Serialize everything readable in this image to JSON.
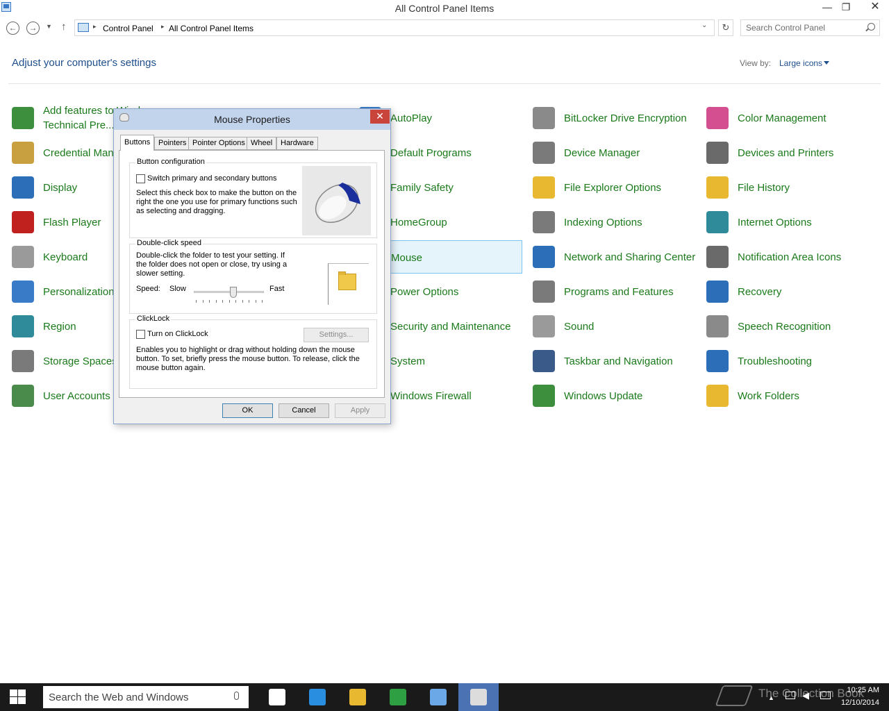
{
  "window": {
    "title": "All Control Panel Items",
    "minimize": "—",
    "maximize": "❐",
    "close": "✕"
  },
  "address": {
    "crumbs": [
      "Control Panel",
      "All Control Panel Items"
    ],
    "search_placeholder": "Search Control Panel"
  },
  "header": {
    "heading": "Adjust your computer's settings",
    "view_by_label": "View by:",
    "view_by_value": "Large icons"
  },
  "items": [
    {
      "label": "Add features to Windows Technical Pre...",
      "icon": "add-features-icon",
      "color": "#3d8f3d"
    },
    {
      "label": "AutoPlay",
      "icon": "autoplay-icon",
      "color": "#3a7bc8"
    },
    {
      "label": "BitLocker Drive Encryption",
      "icon": "bitlocker-icon",
      "color": "#8a8a8a"
    },
    {
      "label": "Color Management",
      "icon": "color-management-icon",
      "color": "#d44f8f"
    },
    {
      "label": "Credential Manager",
      "icon": "credential-manager-icon",
      "color": "#c8a040"
    },
    {
      "label": "Default Programs",
      "icon": "default-programs-icon",
      "color": "#3d8f3d"
    },
    {
      "label": "Device Manager",
      "icon": "device-manager-icon",
      "color": "#7a7a7a"
    },
    {
      "label": "Devices and Printers",
      "icon": "devices-printers-icon",
      "color": "#6a6a6a"
    },
    {
      "label": "Display",
      "icon": "display-icon",
      "color": "#2c6fb8"
    },
    {
      "label": "Family Safety",
      "icon": "family-safety-icon",
      "color": "#3d8f3d"
    },
    {
      "label": "File Explorer Options",
      "icon": "file-explorer-options-icon",
      "color": "#e8b830"
    },
    {
      "label": "File History",
      "icon": "file-history-icon",
      "color": "#e8b830"
    },
    {
      "label": "Flash Player",
      "icon": "flash-player-icon",
      "color": "#c0201e"
    },
    {
      "label": "HomeGroup",
      "icon": "homegroup-icon",
      "color": "#2c6fb8"
    },
    {
      "label": "Indexing Options",
      "icon": "indexing-options-icon",
      "color": "#7a7a7a"
    },
    {
      "label": "Internet Options",
      "icon": "internet-options-icon",
      "color": "#2f8a9a"
    },
    {
      "label": "Keyboard",
      "icon": "keyboard-icon",
      "color": "#9a9a9a"
    },
    {
      "label": "Mouse",
      "icon": "mouse-icon",
      "color": "#9a9a9a"
    },
    {
      "label": "Network and Sharing Center",
      "icon": "network-sharing-icon",
      "color": "#2c6fb8"
    },
    {
      "label": "Notification Area Icons",
      "icon": "notification-area-icon",
      "color": "#6a6a6a"
    },
    {
      "label": "Personalization",
      "icon": "personalization-icon",
      "color": "#3a7bc8"
    },
    {
      "label": "Power Options",
      "icon": "power-options-icon",
      "color": "#3d8f3d"
    },
    {
      "label": "Programs and Features",
      "icon": "programs-features-icon",
      "color": "#7a7a7a"
    },
    {
      "label": "Recovery",
      "icon": "recovery-icon",
      "color": "#2c6fb8"
    },
    {
      "label": "Region",
      "icon": "region-icon",
      "color": "#2f8a9a"
    },
    {
      "label": "Security and Maintenance",
      "icon": "security-maintenance-icon",
      "color": "#2c6fb8"
    },
    {
      "label": "Sound",
      "icon": "sound-icon",
      "color": "#9a9a9a"
    },
    {
      "label": "Speech Recognition",
      "icon": "speech-recognition-icon",
      "color": "#8a8a8a"
    },
    {
      "label": "Storage Spaces",
      "icon": "storage-spaces-icon",
      "color": "#7a7a7a"
    },
    {
      "label": "System",
      "icon": "system-icon",
      "color": "#2c6fb8"
    },
    {
      "label": "Taskbar and Navigation",
      "icon": "taskbar-navigation-icon",
      "color": "#3a5a8a"
    },
    {
      "label": "Troubleshooting",
      "icon": "troubleshooting-icon",
      "color": "#2c6fb8"
    },
    {
      "label": "User Accounts",
      "icon": "user-accounts-icon",
      "color": "#4a8a4a"
    },
    {
      "label": "Windows Firewall",
      "icon": "windows-firewall-icon",
      "color": "#c84a2a"
    },
    {
      "label": "Windows Update",
      "icon": "windows-update-icon",
      "color": "#3d8f3d"
    },
    {
      "label": "Work Folders",
      "icon": "work-folders-icon",
      "color": "#e8b830"
    }
  ],
  "dialog": {
    "title": "Mouse Properties",
    "close": "✕",
    "tabs": [
      "Buttons",
      "Pointers",
      "Pointer Options",
      "Wheel",
      "Hardware"
    ],
    "active_tab": "Buttons",
    "button_config": {
      "label": "Button configuration",
      "checkbox_label": "Switch primary and secondary buttons",
      "checked": false,
      "description": "Select this check box to make the button on the right the one you use for primary functions such as selecting and dragging."
    },
    "double_click": {
      "label": "Double-click speed",
      "description": "Double-click the folder to test your setting. If the folder does not open or close, try using a slower setting.",
      "speed_label": "Speed:",
      "slow": "Slow",
      "fast": "Fast",
      "speed_level": 0.55
    },
    "clicklock": {
      "label": "ClickLock",
      "checkbox_label": "Turn on ClickLock",
      "checked": false,
      "settings_button": "Settings...",
      "description": "Enables you to highlight or drag without holding down the mouse button. To set, briefly press the mouse button. To release, click the mouse button again."
    },
    "ok": "OK",
    "cancel": "Cancel",
    "apply": "Apply"
  },
  "taskbar": {
    "search_placeholder": "Search the Web and Windows",
    "apps": [
      "task-view-icon",
      "internet-explorer-icon",
      "file-explorer-icon",
      "store-icon",
      "control-panel-icon",
      "mouse-properties-icon"
    ],
    "active_app": "mouse-properties-icon",
    "time": "10:25 AM",
    "date": "12/10/2014",
    "watermark": "The Collection Book"
  },
  "colors": {
    "link_green": "#1a7a1a",
    "heading_blue": "#1e4e8c",
    "taskbar": "#1a1a1a",
    "taskbar_active": "#4b73b3",
    "selected_item_bg": "#e5f3fb"
  }
}
